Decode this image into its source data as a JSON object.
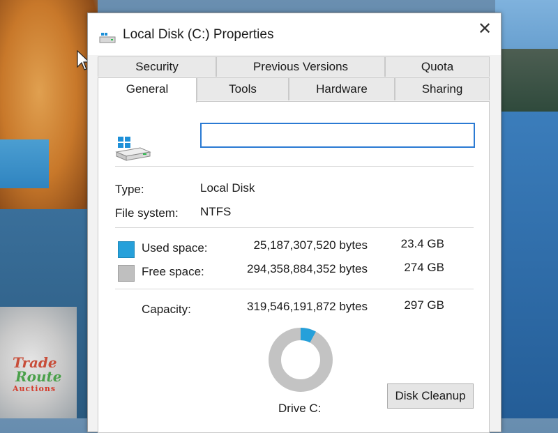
{
  "window": {
    "title": "Local Disk (C:) Properties",
    "close_label": "✕"
  },
  "tabs": {
    "back_row": [
      "Security",
      "Previous Versions",
      "Quota"
    ],
    "front_row": [
      "General",
      "Tools",
      "Hardware",
      "Sharing"
    ],
    "active": "General"
  },
  "general": {
    "name_value": "",
    "type_label": "Type:",
    "type_value": "Local Disk",
    "fs_label": "File system:",
    "fs_value": "NTFS",
    "used_label": "Used space:",
    "used_bytes": "25,187,307,520 bytes",
    "used_gb": "23.4 GB",
    "free_label": "Free space:",
    "free_bytes": "294,358,884,352 bytes",
    "free_gb": "274 GB",
    "capacity_label": "Capacity:",
    "capacity_bytes": "319,546,191,872 bytes",
    "capacity_gb": "297 GB",
    "drive_label": "Drive C:",
    "cleanup_label": "Disk Cleanup",
    "used_fraction": 0.079
  },
  "colors": {
    "used": "#26a0da",
    "free": "#bfbfbf",
    "accent": "#2b7ad3"
  },
  "watermark": {
    "line1": "Trade",
    "line2": "Route",
    "line3": "Auctions"
  }
}
